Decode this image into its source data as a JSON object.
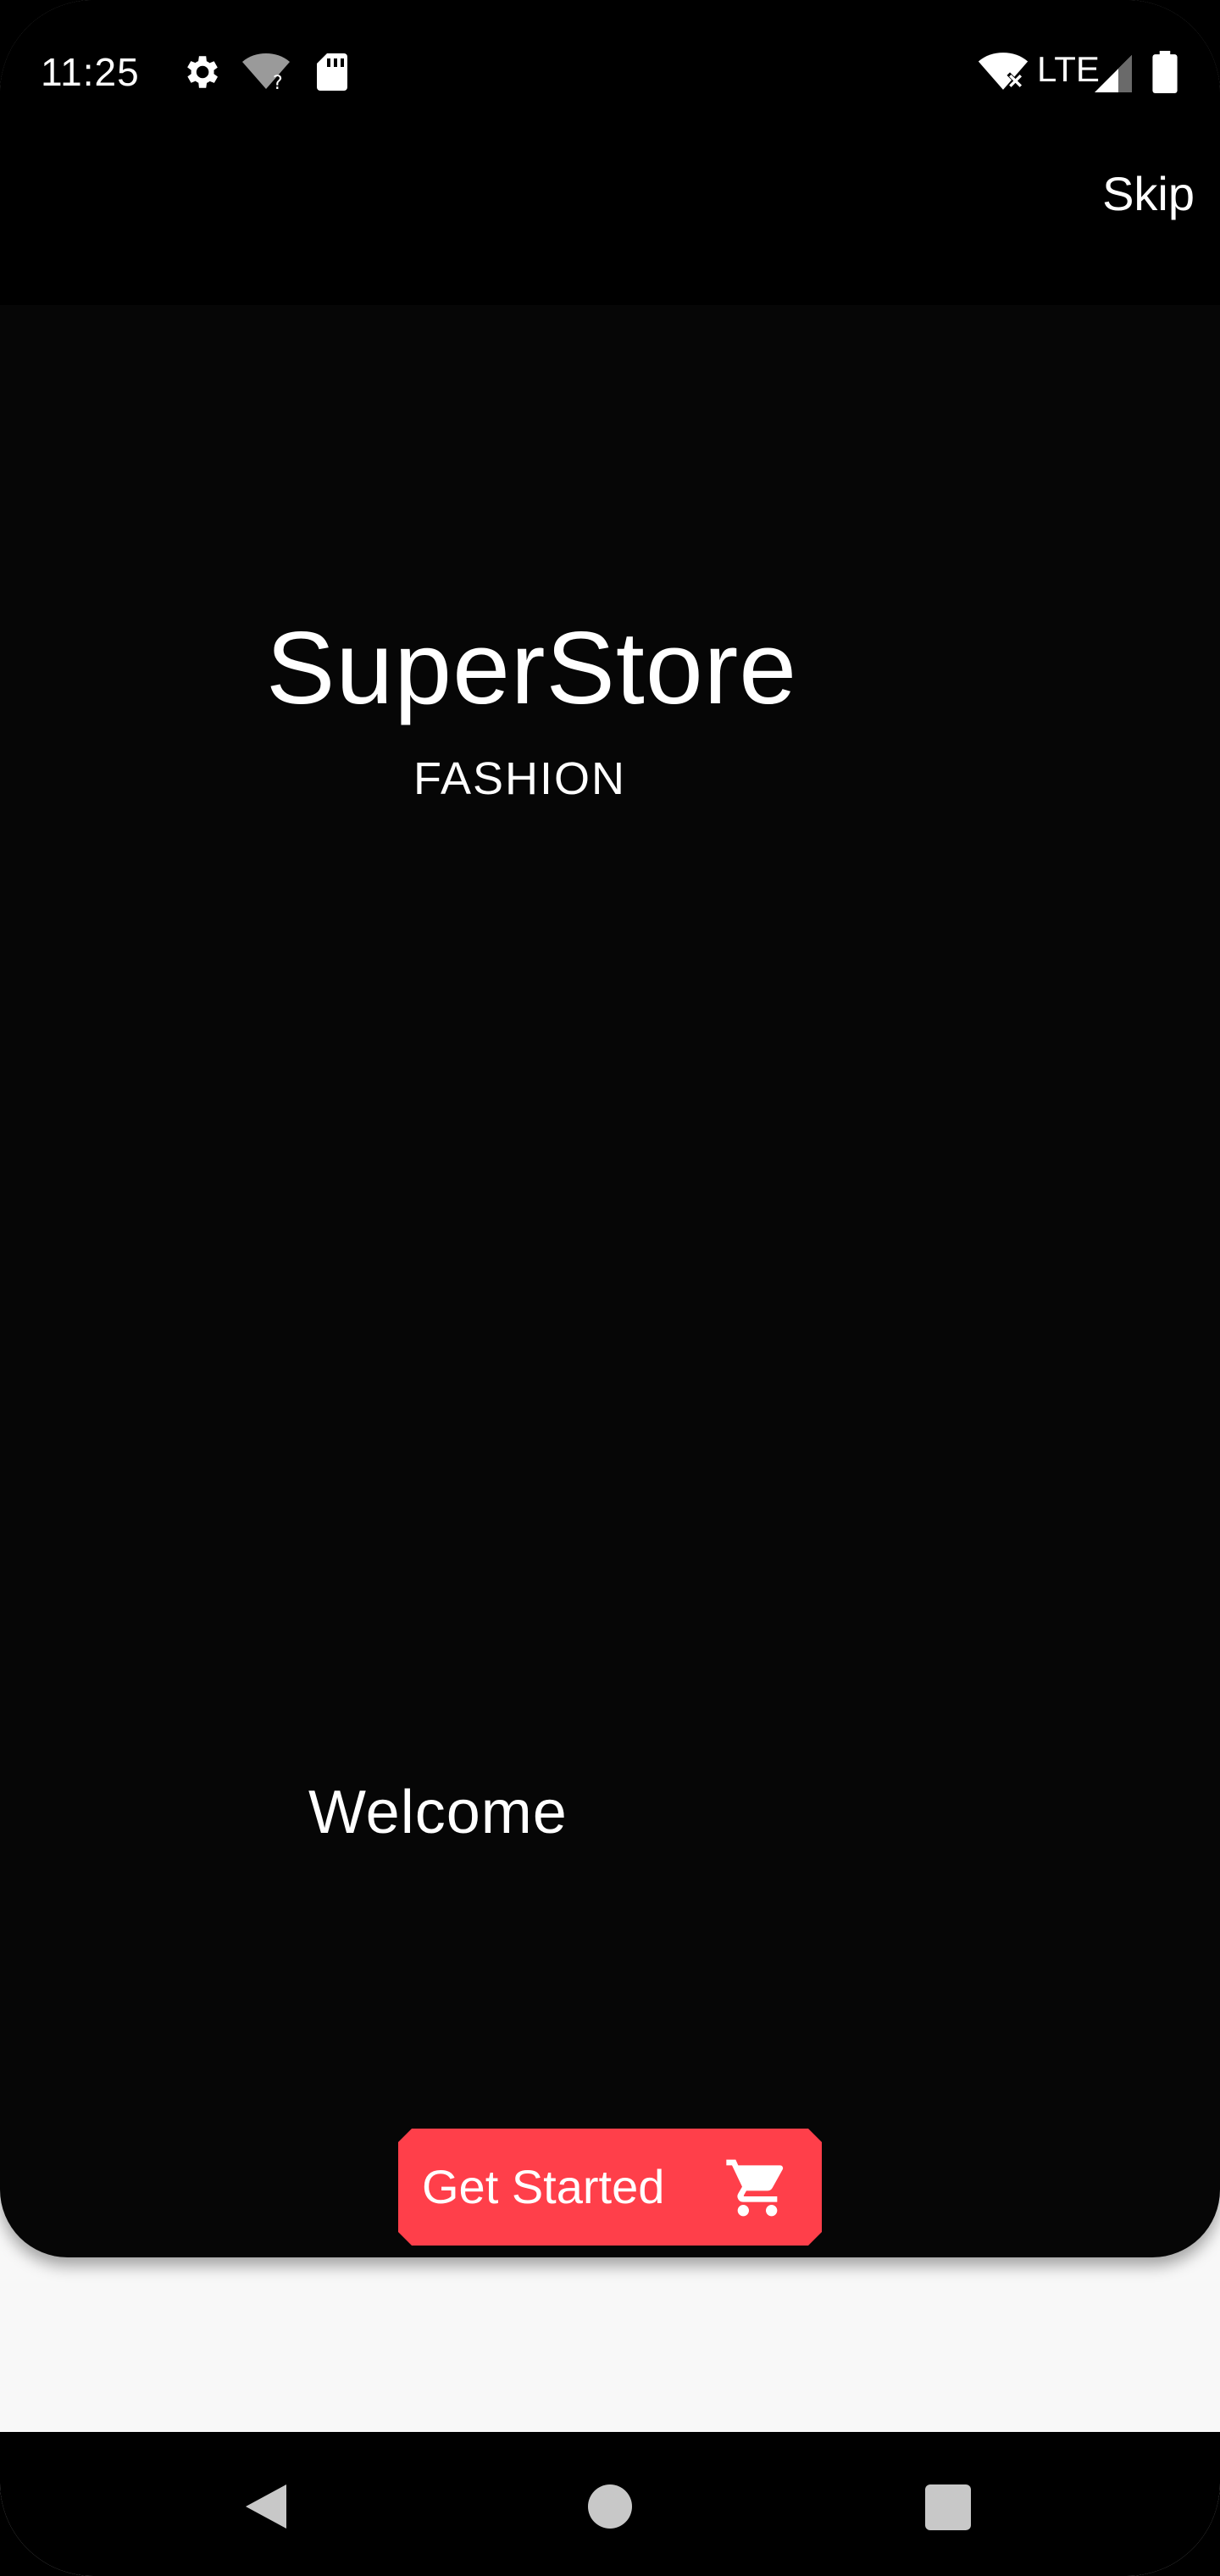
{
  "status_bar": {
    "time": "11:25",
    "network_label": "LTE",
    "icons": [
      "settings-icon",
      "wifi-unknown-icon",
      "sd-card-icon",
      "wifi-off-icon",
      "signal-icon",
      "battery-icon"
    ]
  },
  "header": {
    "skip_label": "Skip"
  },
  "brand": {
    "title": "SuperStore",
    "subtitle": "FASHION"
  },
  "welcome": {
    "text": "Welcome"
  },
  "cta": {
    "label": "Get Started",
    "icon": "cart-icon",
    "color": "#ff3f4a"
  },
  "nav_bar": {
    "buttons": [
      "back-icon",
      "home-icon",
      "recents-icon"
    ]
  },
  "colors": {
    "background": "#060606",
    "bottom_area": "#f8f8f8",
    "accent": "#ff3f4a",
    "text": "#ffffff"
  }
}
